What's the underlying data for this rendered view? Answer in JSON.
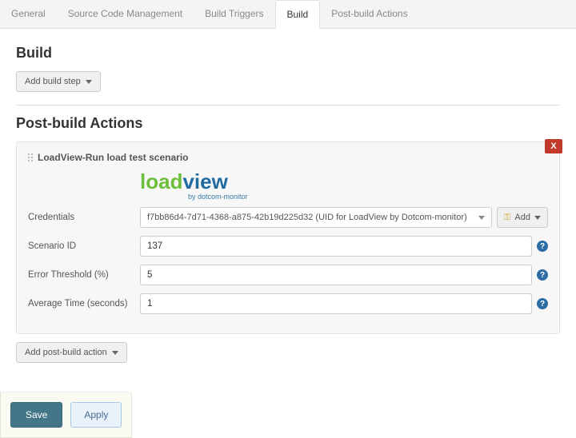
{
  "tabs": {
    "items": [
      {
        "label": "General"
      },
      {
        "label": "Source Code Management"
      },
      {
        "label": "Build Triggers"
      },
      {
        "label": "Build"
      },
      {
        "label": "Post-build Actions"
      }
    ],
    "activeIndex": 3
  },
  "build": {
    "title": "Build",
    "add_step_label": "Add build step"
  },
  "postbuild": {
    "title": "Post-build Actions",
    "add_action_label": "Add post-build action",
    "close_label": "X",
    "block": {
      "title": "LoadView-Run load test scenario",
      "logo": {
        "part_green": "load",
        "part_blue": "view",
        "sub": "by dotcom-monitor"
      },
      "fields": {
        "credentials": {
          "label": "Credentials",
          "selected": "f7bb86d4-7d71-4368-a875-42b19d225d32 (UID for LoadView by Dotcom-monitor)",
          "add_label": "Add"
        },
        "scenario_id": {
          "label": "Scenario ID",
          "value": "137"
        },
        "error_threshold": {
          "label": "Error Threshold (%)",
          "value": "5"
        },
        "avg_time": {
          "label": "Average Time (seconds)",
          "value": "1"
        }
      }
    }
  },
  "footer": {
    "save": "Save",
    "apply": "Apply"
  },
  "help": {
    "glyph": "?"
  }
}
